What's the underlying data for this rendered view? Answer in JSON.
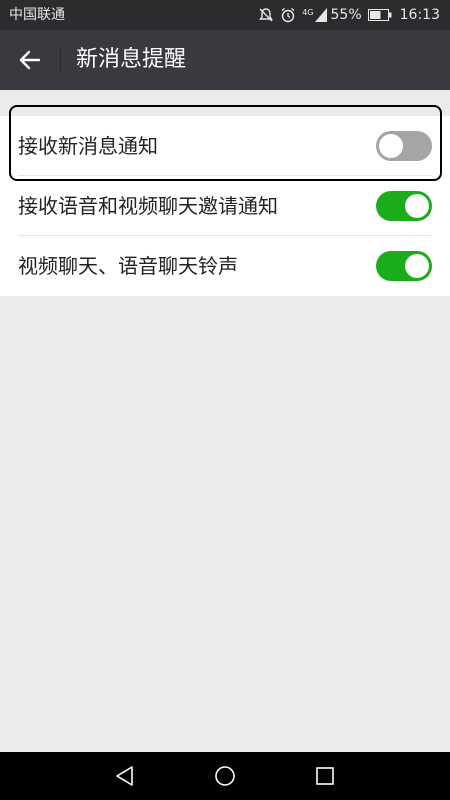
{
  "status_bar": {
    "carrier": "中国联通",
    "network": "4G",
    "battery": "55%",
    "time": "16:13",
    "icons": [
      "mute-icon",
      "alarm-icon",
      "signal-icon",
      "battery-icon"
    ]
  },
  "app_bar": {
    "title": "新消息提醒",
    "back_icon": "arrow-left-icon"
  },
  "settings": [
    {
      "label": "接收新消息通知",
      "enabled": false
    },
    {
      "label": "接收语音和视频聊天邀请通知",
      "enabled": true
    },
    {
      "label": "视频聊天、语音聊天铃声",
      "enabled": true
    }
  ],
  "nav_bar": {
    "icons": [
      "triangle-back-icon",
      "circle-home-icon",
      "square-recent-icon"
    ]
  },
  "colors": {
    "status_bar_bg": "#2b2c2e",
    "app_bar_bg": "#393a3f",
    "page_bg": "#ebebeb",
    "toggle_on": "#1aad19",
    "toggle_off": "#a5a5a5"
  }
}
